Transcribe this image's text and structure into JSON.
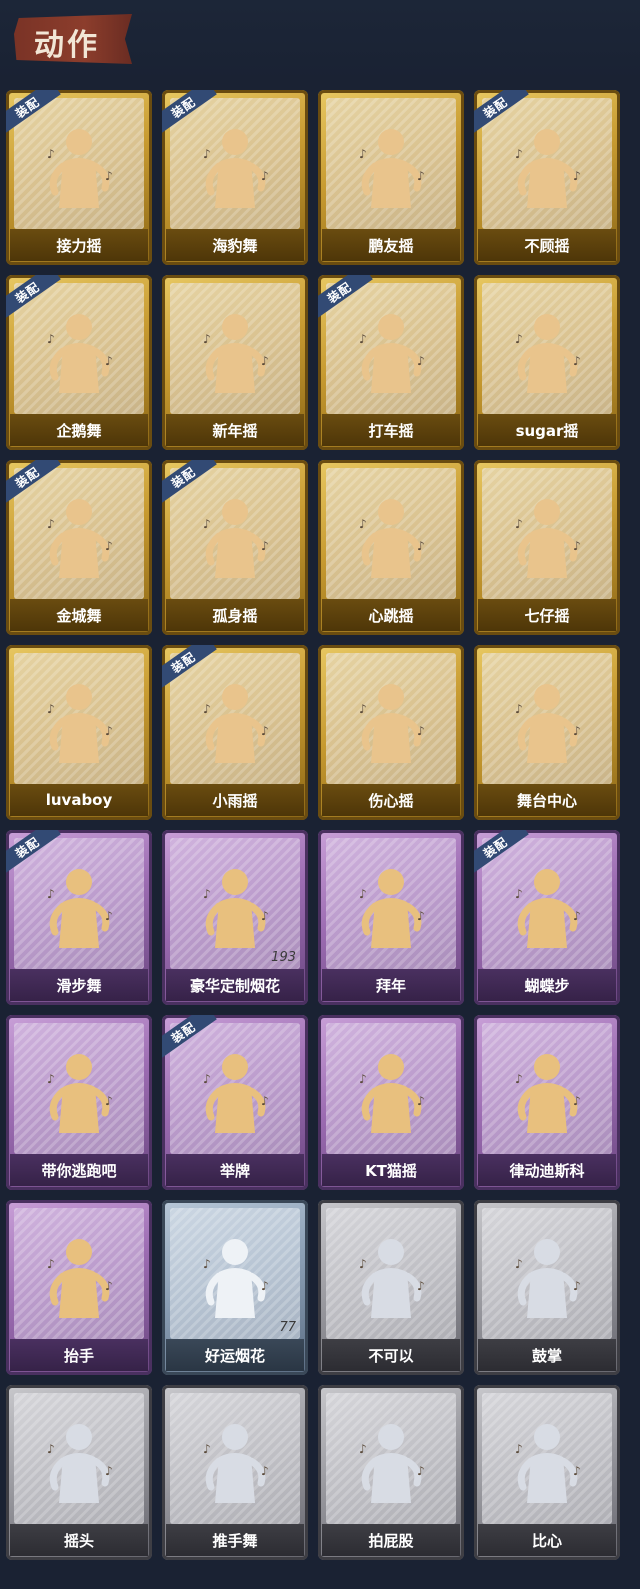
{
  "header": {
    "title": "动作"
  },
  "equip_label": "装配",
  "cards": [
    {
      "label": "接力摇",
      "rarity": "gold",
      "equipped": true
    },
    {
      "label": "海豹舞",
      "rarity": "gold",
      "equipped": true
    },
    {
      "label": "鹏友摇",
      "rarity": "gold",
      "equipped": false
    },
    {
      "label": "不顾摇",
      "rarity": "gold",
      "equipped": true
    },
    {
      "label": "企鹅舞",
      "rarity": "gold",
      "equipped": true
    },
    {
      "label": "新年摇",
      "rarity": "gold",
      "equipped": false
    },
    {
      "label": "打车摇",
      "rarity": "gold",
      "equipped": true
    },
    {
      "label": "sugar摇",
      "rarity": "gold",
      "equipped": false
    },
    {
      "label": "金城舞",
      "rarity": "gold",
      "equipped": true
    },
    {
      "label": "孤身摇",
      "rarity": "gold",
      "equipped": true
    },
    {
      "label": "心跳摇",
      "rarity": "gold",
      "equipped": false
    },
    {
      "label": "七仔摇",
      "rarity": "gold",
      "equipped": false
    },
    {
      "label": "luvaboy",
      "rarity": "gold",
      "equipped": false
    },
    {
      "label": "小雨摇",
      "rarity": "gold",
      "equipped": true
    },
    {
      "label": "伤心摇",
      "rarity": "gold",
      "equipped": false
    },
    {
      "label": "舞台中心",
      "rarity": "gold",
      "equipped": false
    },
    {
      "label": "滑步舞",
      "rarity": "purple",
      "equipped": true
    },
    {
      "label": "豪华定制烟花",
      "rarity": "purple",
      "equipped": false,
      "count": "193"
    },
    {
      "label": "拜年",
      "rarity": "purple",
      "equipped": false
    },
    {
      "label": "蝴蝶步",
      "rarity": "purple",
      "equipped": true
    },
    {
      "label": "带你逃跑吧",
      "rarity": "purple",
      "equipped": false
    },
    {
      "label": "举牌",
      "rarity": "purple",
      "equipped": true
    },
    {
      "label": "KT猫摇",
      "rarity": "purple",
      "equipped": false
    },
    {
      "label": "律动迪斯科",
      "rarity": "purple",
      "equipped": false
    },
    {
      "label": "抬手",
      "rarity": "purple",
      "equipped": false
    },
    {
      "label": "好运烟花",
      "rarity": "blue",
      "equipped": false,
      "count": "77"
    },
    {
      "label": "不可以",
      "rarity": "gray",
      "equipped": false
    },
    {
      "label": "鼓掌",
      "rarity": "gray",
      "equipped": false
    },
    {
      "label": "摇头",
      "rarity": "gray",
      "equipped": false
    },
    {
      "label": "推手舞",
      "rarity": "gray",
      "equipped": false
    },
    {
      "label": "拍屁股",
      "rarity": "gray",
      "equipped": false
    },
    {
      "label": "比心",
      "rarity": "gray",
      "equipped": false
    }
  ],
  "colors": {
    "gold": "#c79a30",
    "purple": "#9c6cb2",
    "blue": "#8ca0b6",
    "gray": "#9a9aa0",
    "equip_tag": "#324a74",
    "background": "#1a2233"
  },
  "icons": {
    "figure": "dancer-silhouette-icon",
    "equip": "equip-tag-icon"
  }
}
